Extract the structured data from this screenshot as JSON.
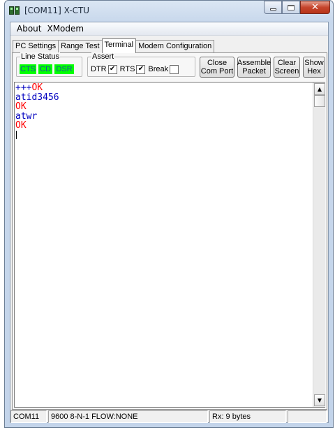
{
  "window": {
    "title": "[COM11] X-CTU"
  },
  "menu": [
    "About",
    "XModem"
  ],
  "tabs": [
    "PC Settings",
    "Range Test",
    "Terminal",
    "Modem Configuration"
  ],
  "active_tab": "Terminal",
  "line_status": {
    "label": "Line Status",
    "indicators": [
      "CTS",
      "CD",
      "DSR"
    ],
    "indicator_color": "#00ff00"
  },
  "assert": {
    "label": "Assert",
    "items": [
      {
        "label": "DTR",
        "checked": true,
        "mark": "✔"
      },
      {
        "label": "RTS",
        "checked": true,
        "mark": "✔"
      },
      {
        "label": "Break",
        "checked": false,
        "mark": ""
      }
    ]
  },
  "buttons": {
    "close_com_port": "Close\nCom Port",
    "assemble_packet": "Assemble\nPacket",
    "clear_screen": "Clear\nScreen",
    "show_hex": "Show\nHex"
  },
  "terminal": {
    "lines": [
      {
        "text": "+++",
        "color": "#0000c0",
        "suffix": "OK",
        "suffix_color": "#ff0000"
      },
      {
        "text": "atid3456",
        "color": "#0000c0"
      },
      {
        "text": "OK",
        "color": "#ff0000"
      },
      {
        "text": "atwr",
        "color": "#0000c0"
      },
      {
        "text": "OK",
        "color": "#ff0000"
      }
    ]
  },
  "status_bar": {
    "port": "COM11",
    "settings": "9600 8-N-1  FLOW:NONE",
    "rx": "Rx: 9 bytes"
  },
  "icons": {
    "scroll_up": "▲",
    "scroll_down": "▼",
    "close": "✕"
  }
}
